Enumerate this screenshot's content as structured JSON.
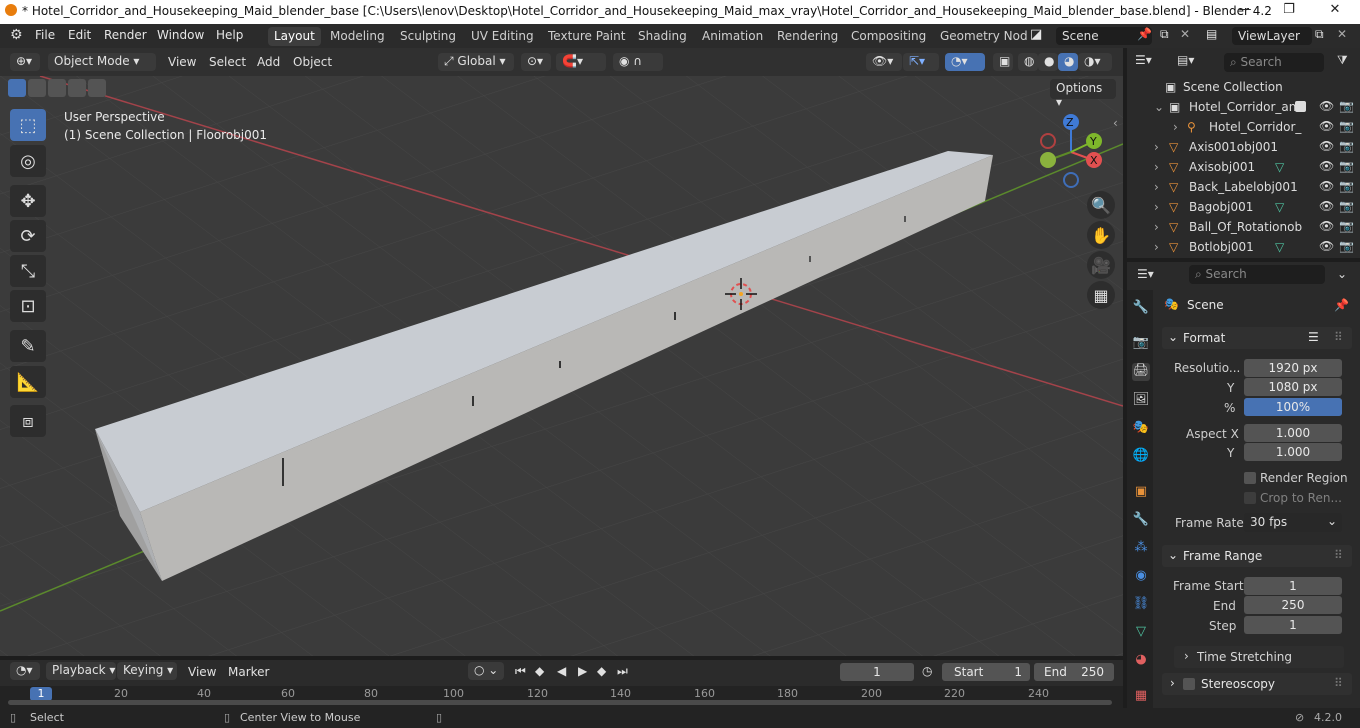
{
  "window": {
    "title": "* Hotel_Corridor_and_Housekeeping_Maid_blender_base [C:\\Users\\lenov\\Desktop\\Hotel_Corridor_and_Housekeeping_Maid_max_vray\\Hotel_Corridor_and_Housekeeping_Maid_blender_base.blend] - Blender 4.2",
    "minimize": "—",
    "maximize": "❐",
    "close": "✕"
  },
  "menu": [
    "File",
    "Edit",
    "Render",
    "Window",
    "Help"
  ],
  "workspaces": [
    "Layout",
    "Modeling",
    "Sculpting",
    "UV Editing",
    "Texture Paint",
    "Shading",
    "Animation",
    "Rendering",
    "Compositing",
    "Geometry Nod"
  ],
  "scene_name": "Scene",
  "view_layer": "ViewLayer",
  "header": {
    "mode": "Object Mode",
    "view": "View",
    "select": "Select",
    "add": "Add",
    "object": "Object",
    "orientation": "Global",
    "options": "Options"
  },
  "viewport": {
    "perspective": "User Perspective",
    "context": "(1) Scene Collection | Floorobj001"
  },
  "gizmo": {
    "x": "X",
    "y": "Y",
    "z": "Z"
  },
  "outliner": {
    "search_placeholder": "Search",
    "root": "Scene Collection",
    "rows": [
      {
        "name": "Hotel_Corridor_anc",
        "indent": 1,
        "icon": "collection"
      },
      {
        "name": "Hotel_Corridor_",
        "indent": 2,
        "icon": "armature"
      },
      {
        "name": "Axis001obj001",
        "indent": 1,
        "icon": "object"
      },
      {
        "name": "Axisobj001",
        "indent": 1,
        "icon": "object"
      },
      {
        "name": "Back_Labelobj001",
        "indent": 1,
        "icon": "object"
      },
      {
        "name": "Bagobj001",
        "indent": 1,
        "icon": "object"
      },
      {
        "name": "Ball_Of_Rotationob",
        "indent": 1,
        "icon": "object"
      },
      {
        "name": "Botlobj001",
        "indent": 1,
        "icon": "object"
      }
    ]
  },
  "properties": {
    "search_placeholder": "Search",
    "context": "Scene",
    "format": {
      "title": "Format",
      "res_label": "Resolutio...",
      "res_x": "1920 px",
      "y_label": "Y",
      "res_y": "1080 px",
      "pct_label": "%",
      "pct": "100%",
      "pct_fraction": 1.0,
      "aspect_x_label": "Aspect X",
      "aspect_x": "1.000",
      "aspect_y_label": "Y",
      "aspect_y": "1.000",
      "render_region": "Render Region",
      "crop": "Crop to Ren...",
      "frame_rate_label": "Frame Rate",
      "frame_rate": "30 fps"
    },
    "frame_range": {
      "title": "Frame Range",
      "start_label": "Frame Start",
      "start": "1",
      "end_label": "End",
      "end": "250",
      "step_label": "Step",
      "step": "1",
      "time_stretching": "Time Stretching"
    },
    "stereoscopy": "Stereoscopy"
  },
  "timeline": {
    "playback": "Playback",
    "keying": "Keying",
    "view": "View",
    "marker": "Marker",
    "current": "1",
    "start_label": "Start",
    "start": "1",
    "end_label": "End",
    "end": "250",
    "ticks": [
      "1",
      "20",
      "40",
      "60",
      "80",
      "100",
      "120",
      "140",
      "160",
      "180",
      "200",
      "220",
      "240"
    ]
  },
  "status": {
    "select": "Select",
    "center": "Center View to Mouse",
    "version": "4.2.0"
  }
}
